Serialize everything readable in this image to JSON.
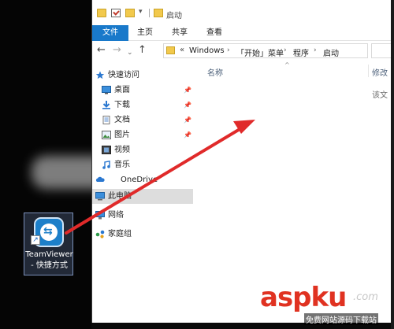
{
  "window": {
    "title": "启动"
  },
  "ribbon": {
    "tabs": [
      "文件",
      "主页",
      "共享",
      "查看"
    ]
  },
  "nav": {
    "back": "←",
    "forward": "→",
    "recent": "⌄",
    "up": "↑"
  },
  "address": {
    "overflow": "«",
    "crumbs": [
      "Windows",
      "「开始」菜单",
      "程序",
      "启动"
    ],
    "separator": "›"
  },
  "navpane": {
    "quick_access": "快速访问",
    "items": [
      {
        "label": "桌面",
        "icon": "desktop-icon",
        "pinned": true
      },
      {
        "label": "下载",
        "icon": "download-icon",
        "pinned": true
      },
      {
        "label": "文档",
        "icon": "documents-icon",
        "pinned": true
      },
      {
        "label": "图片",
        "icon": "pictures-icon",
        "pinned": true
      },
      {
        "label": "视频",
        "icon": "videos-icon",
        "pinned": false
      },
      {
        "label": "音乐",
        "icon": "music-icon",
        "pinned": false
      }
    ],
    "onedrive": "OneDrive",
    "this_pc": "此电脑",
    "network": "网络",
    "homegroup": "家庭组",
    "pin_glyph": "📌"
  },
  "main": {
    "col_name": "名称",
    "col_modified": "修改",
    "sort_arrow": "^",
    "empty_text": "该文"
  },
  "desktop": {
    "shortcut_label": "TeamViewer - 快捷方式",
    "shortcut_overlay": "↗"
  },
  "watermark": {
    "brand": "aspku",
    "suffix": ".com",
    "sub": "免费网站源码下载站"
  },
  "colors": {
    "accent": "#1979ca",
    "arrow": "#e02a2a",
    "watermark": "#e03221"
  }
}
